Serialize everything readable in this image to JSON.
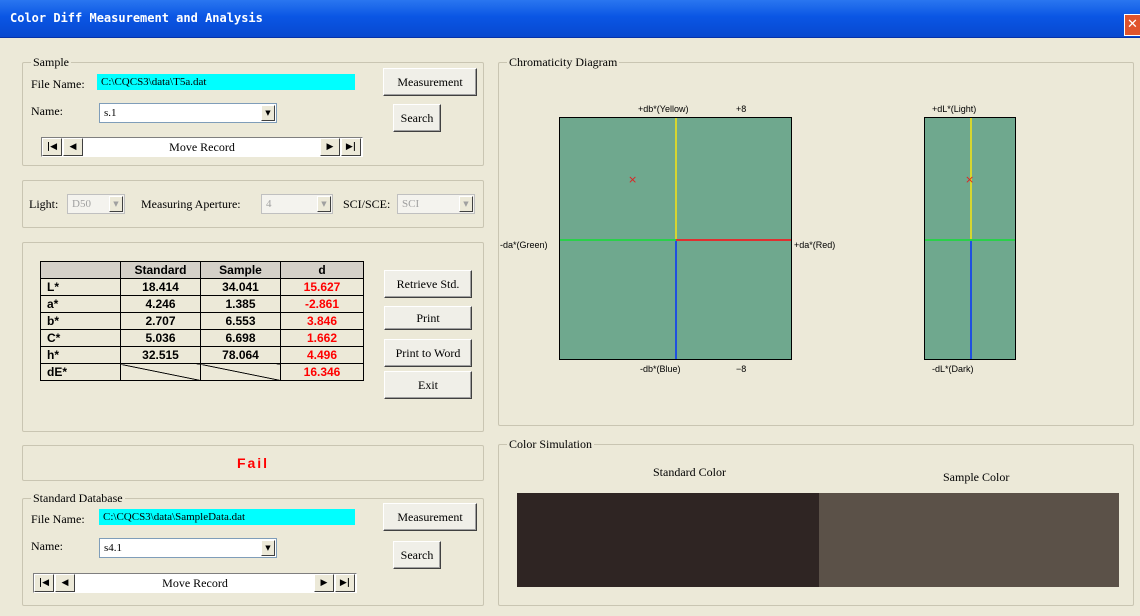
{
  "window": {
    "title": "Color Diff Measurement and Analysis",
    "close_glyph": "✕"
  },
  "sample": {
    "group_title": "Sample",
    "file_label": "File Name:",
    "file_value": "C:\\CQCS3\\data\\T5a.dat",
    "name_label": "Name:",
    "name_value": "s.1",
    "measure_button": "Measurement",
    "search_button": "Search",
    "move_record": "Move Record"
  },
  "settings": {
    "light_label": "Light:",
    "light_value": "D50",
    "aperture_label": "Measuring Aperture:",
    "aperture_value": "4",
    "scisce_label": "SCI/SCE:",
    "scisce_value": "SCI"
  },
  "table": {
    "headers": [
      "",
      "Standard",
      "Sample",
      "d"
    ],
    "rows": [
      {
        "label": "L*",
        "standard": "18.414",
        "sample": "34.041",
        "d": "15.627"
      },
      {
        "label": "a*",
        "standard": "4.246",
        "sample": "1.385",
        "d": "-2.861"
      },
      {
        "label": "b*",
        "standard": "2.707",
        "sample": "6.553",
        "d": "3.846"
      },
      {
        "label": "C*",
        "standard": "5.036",
        "sample": "6.698",
        "d": "1.662"
      },
      {
        "label": "h*",
        "standard": "32.515",
        "sample": "78.064",
        "d": "4.496"
      },
      {
        "label": "dE*",
        "standard": "",
        "sample": "",
        "d": "16.346"
      }
    ]
  },
  "actions": {
    "retrieve": "Retrieve Std.",
    "print": "Print",
    "print_word": "Print to Word",
    "exit": "Exit"
  },
  "result": {
    "text": "Fail",
    "color": "#ff0000"
  },
  "standard_db": {
    "group_title": "Standard Database",
    "file_label": "File Name:",
    "file_value": "C:\\CQCS3\\data\\SampleData.dat",
    "name_label": "Name:",
    "name_value": "s4.1",
    "measure_button": "Measurement",
    "search_button": "Search",
    "move_record": "Move Record"
  },
  "chromaticity": {
    "group_title": "Chromaticity Diagram",
    "yellow": "+db*(Yellow)",
    "blue": "-db*(Blue)",
    "green": "-da*(Green)",
    "red": "+da*(Red)",
    "top_range": "+8",
    "bottom_range": "−8",
    "light": "+dL*(Light)",
    "dark": "-dL*(Dark)",
    "plot_color": "#6fa88e"
  },
  "simulation": {
    "group_title": "Color Simulation",
    "standard_label": "Standard Color",
    "sample_label": "Sample Color",
    "standard_color": "#2f2523",
    "sample_color": "#5b5148"
  },
  "nav_icons": [
    "first-record-icon",
    "prev-record-icon",
    "next-record-icon",
    "last-record-icon"
  ]
}
